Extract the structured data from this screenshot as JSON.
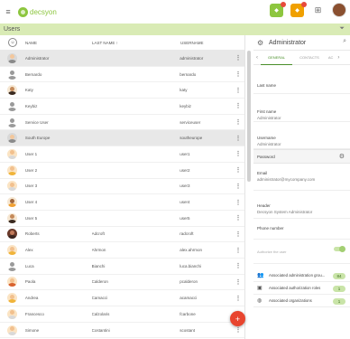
{
  "app": {
    "logo_text": "decsyon",
    "brand_color": "#8dc63f",
    "accent_red": "#e8452f"
  },
  "header": {
    "icons": [
      "menu-icon",
      "notification-icon",
      "notification-icon",
      "apps-icon",
      "user-avatar"
    ]
  },
  "page": {
    "title": "Users"
  },
  "list": {
    "columns": {
      "name": "NAME",
      "last_name": "LAST NAME ↑",
      "username": "USERNAME"
    },
    "rows": [
      {
        "name": "Administrator",
        "last": "",
        "user": "administrator",
        "avatar": "monitor",
        "selected": true
      },
      {
        "name": "Bernardo",
        "last": "",
        "user": "bernardo",
        "avatar": "grey"
      },
      {
        "name": "Katy",
        "last": "",
        "user": "katy",
        "avatar": "woman-dark"
      },
      {
        "name": "Keybiz",
        "last": "",
        "user": "keybiz",
        "avatar": "grey"
      },
      {
        "name": "Service User",
        "last": "",
        "user": "serviceuser",
        "avatar": "grey"
      },
      {
        "name": "South Europe",
        "last": "",
        "user": "southeurope",
        "avatar": "monitor",
        "selected": true
      },
      {
        "name": "User 1",
        "last": "",
        "user": "user1",
        "avatar": "man-light"
      },
      {
        "name": "User 2",
        "last": "",
        "user": "user2",
        "avatar": "woman-blonde"
      },
      {
        "name": "User 3",
        "last": "",
        "user": "user3",
        "avatar": "man-light"
      },
      {
        "name": "User 4",
        "last": "",
        "user": "user4",
        "avatar": "man-dark"
      },
      {
        "name": "User 5",
        "last": "",
        "user": "user5",
        "avatar": "woman-dark"
      },
      {
        "name": "Roberts",
        "last": "Adcroft",
        "user": "radcroft",
        "avatar": "photo"
      },
      {
        "name": "Alex",
        "last": "Ahrmon",
        "user": "alex.ahrmon",
        "avatar": "woman-blonde"
      },
      {
        "name": "Luca",
        "last": "Bianchi",
        "user": "luca.bianchi",
        "avatar": "grey"
      },
      {
        "name": "Paola",
        "last": "Calderon",
        "user": "pcalderon",
        "avatar": "woman-red"
      },
      {
        "name": "Andrea",
        "last": "Camacci",
        "user": "acamacci",
        "avatar": "woman-blonde"
      },
      {
        "name": "Francesco",
        "last": "Calzolaris",
        "user": "fcarbone",
        "avatar": "man-light"
      },
      {
        "name": "Simone",
        "last": "Costantini",
        "user": "scostant",
        "avatar": "man-light"
      }
    ]
  },
  "detail": {
    "title": "Administrator",
    "tabs": [
      "GENERAL",
      "CONTACTS",
      "AC"
    ],
    "fields": {
      "last_name_label": "Last name",
      "first_name_label": "First name",
      "first_name_value": "Administrator",
      "username_label": "Username",
      "username_value": "Administrator",
      "password_label": "Password",
      "email_label": "Email",
      "email_value": "administrator@mycompany.com",
      "header_label": "Header",
      "header_value": "Decsyon System Administrator",
      "phone_label": "Phone number",
      "toggle_label": "Authorize the user"
    },
    "associations": [
      {
        "icon": "group-icon",
        "label": "Associated administration grou...",
        "count": "84"
      },
      {
        "icon": "role-icon",
        "label": "Associated authorization roles",
        "count": "1"
      },
      {
        "icon": "globe-icon",
        "label": "Associated organizations",
        "count": "1"
      }
    ]
  }
}
